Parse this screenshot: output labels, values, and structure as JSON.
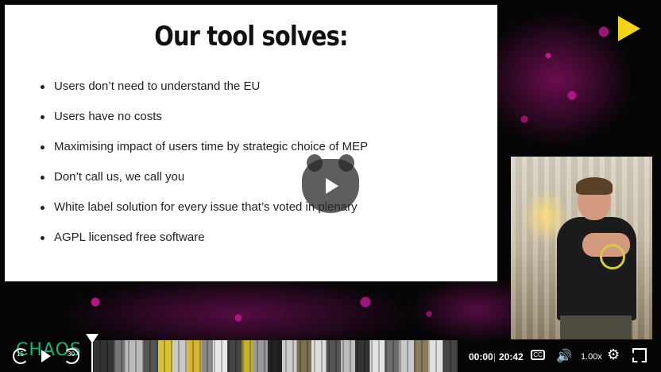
{
  "slide": {
    "title": "Our tool solves:",
    "bullets": [
      "Users don’t need to understand the EU",
      "Users have no costs",
      "Maximising impact of users time by strategic choice of MEP",
      "Don’t call us, we call you",
      "White label solution for every issue that’s voted in plenary",
      "AGPL licensed free software"
    ]
  },
  "player": {
    "brand_text": "CHAOS",
    "rewind_label": "15",
    "forward_label": "30",
    "time_current": "00:00",
    "time_separator": "|",
    "time_total": "20:42",
    "captions_label": "CC",
    "playback_speed": "1.00x",
    "accent_color": "#f5d41d",
    "icons": [
      "rewind-icon",
      "play-icon",
      "forward-icon",
      "captions-icon",
      "volume-icon",
      "settings-icon",
      "fullscreen-icon",
      "big-play-icon"
    ]
  }
}
